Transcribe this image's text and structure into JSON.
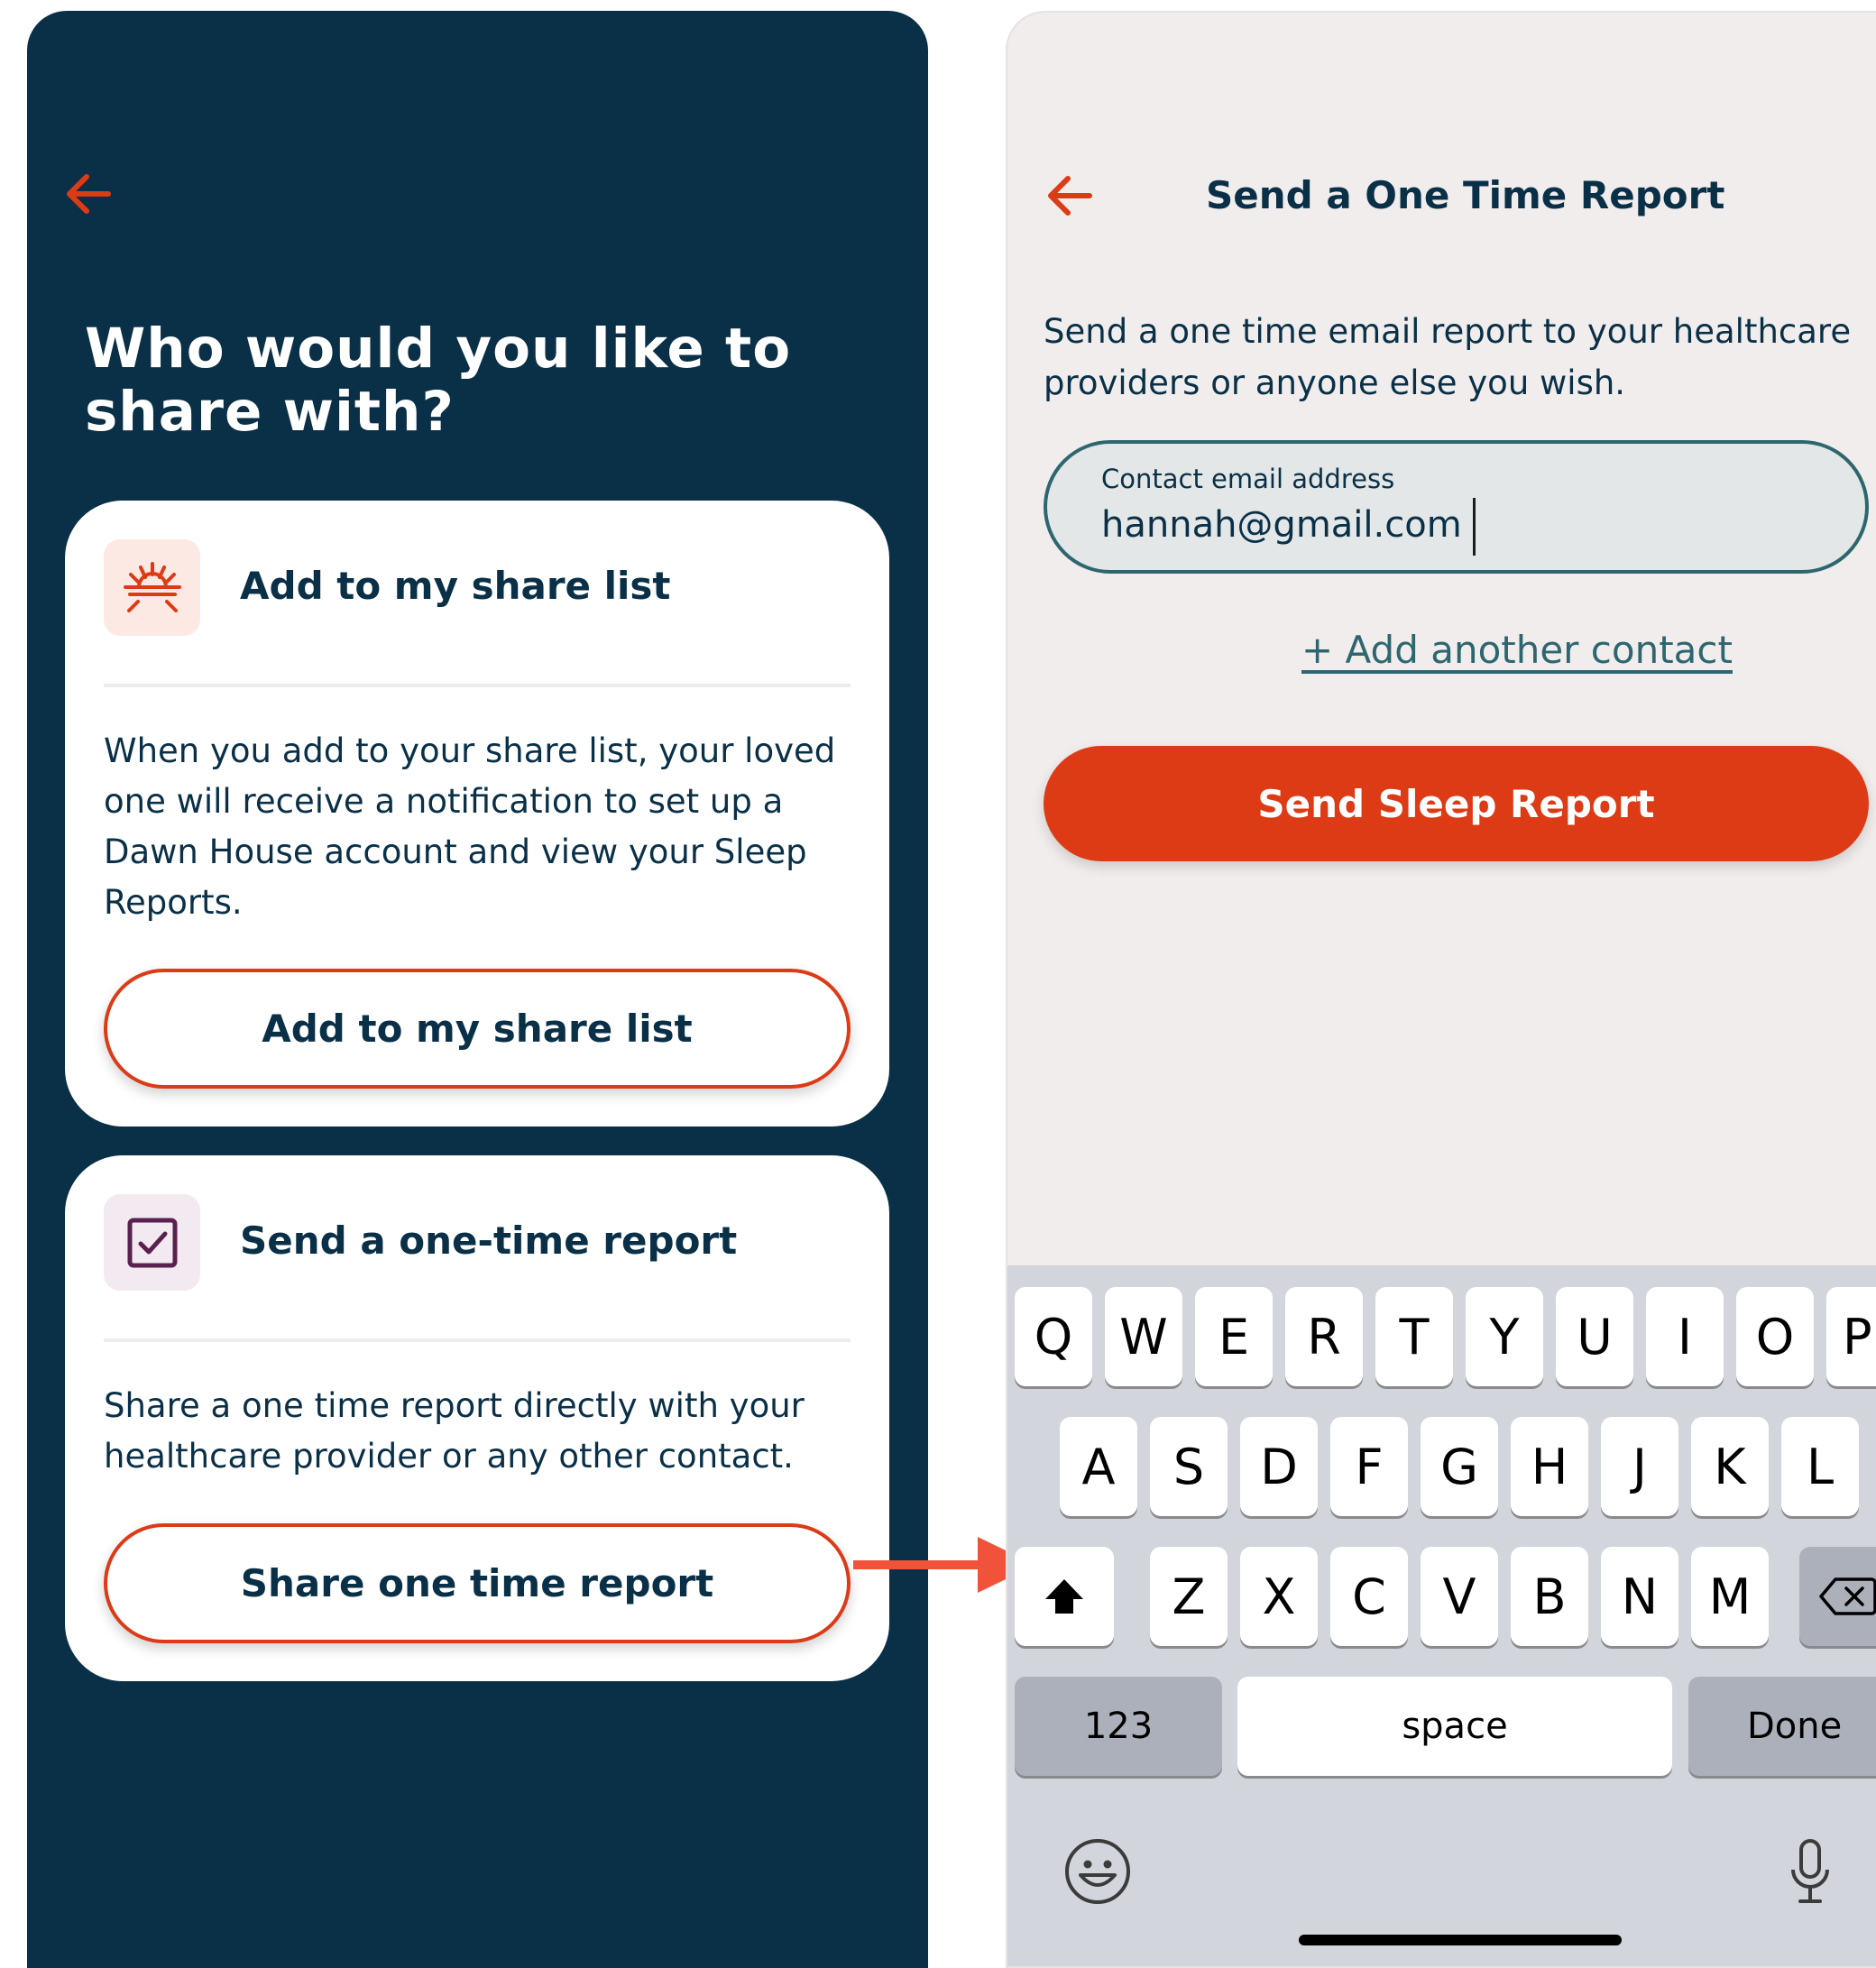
{
  "left_screen": {
    "heading": "Who would you like to share with?",
    "share_list_card": {
      "title": "Add to my share list",
      "description": "When you add to your share list, your loved one will receive a notification to set up a Dawn House account and view your Sleep Reports.",
      "button_label": "Add to my share list",
      "icon": "sunrise-icon"
    },
    "one_time_card": {
      "title": "Send a one-time report",
      "description": "Share a one time report directly with your healthcare provider or any other contact.",
      "button_label": "Share one time report",
      "icon": "checkbox-icon"
    }
  },
  "right_screen": {
    "title": "Send a One Time Report",
    "description": "Send a one time email report to your healthcare providers or anyone else you wish.",
    "email_field": {
      "label": "Contact email address",
      "value": "hannah@gmail.com"
    },
    "add_contact_link": "+ Add another contact",
    "send_button_label": "Send Sleep Report"
  },
  "keyboard": {
    "row1": [
      "Q",
      "W",
      "E",
      "R",
      "T",
      "Y",
      "U",
      "I",
      "O",
      "P"
    ],
    "row2": [
      "A",
      "S",
      "D",
      "F",
      "G",
      "H",
      "J",
      "K",
      "L"
    ],
    "row3": [
      "Z",
      "X",
      "C",
      "V",
      "B",
      "N",
      "M"
    ],
    "numbers_key": "123",
    "space_key": "space",
    "done_key": "Done"
  },
  "colors": {
    "navy": "#0a3048",
    "accent": "#dd3a16",
    "teal": "#2e6670",
    "right_background": "#f1edec"
  }
}
